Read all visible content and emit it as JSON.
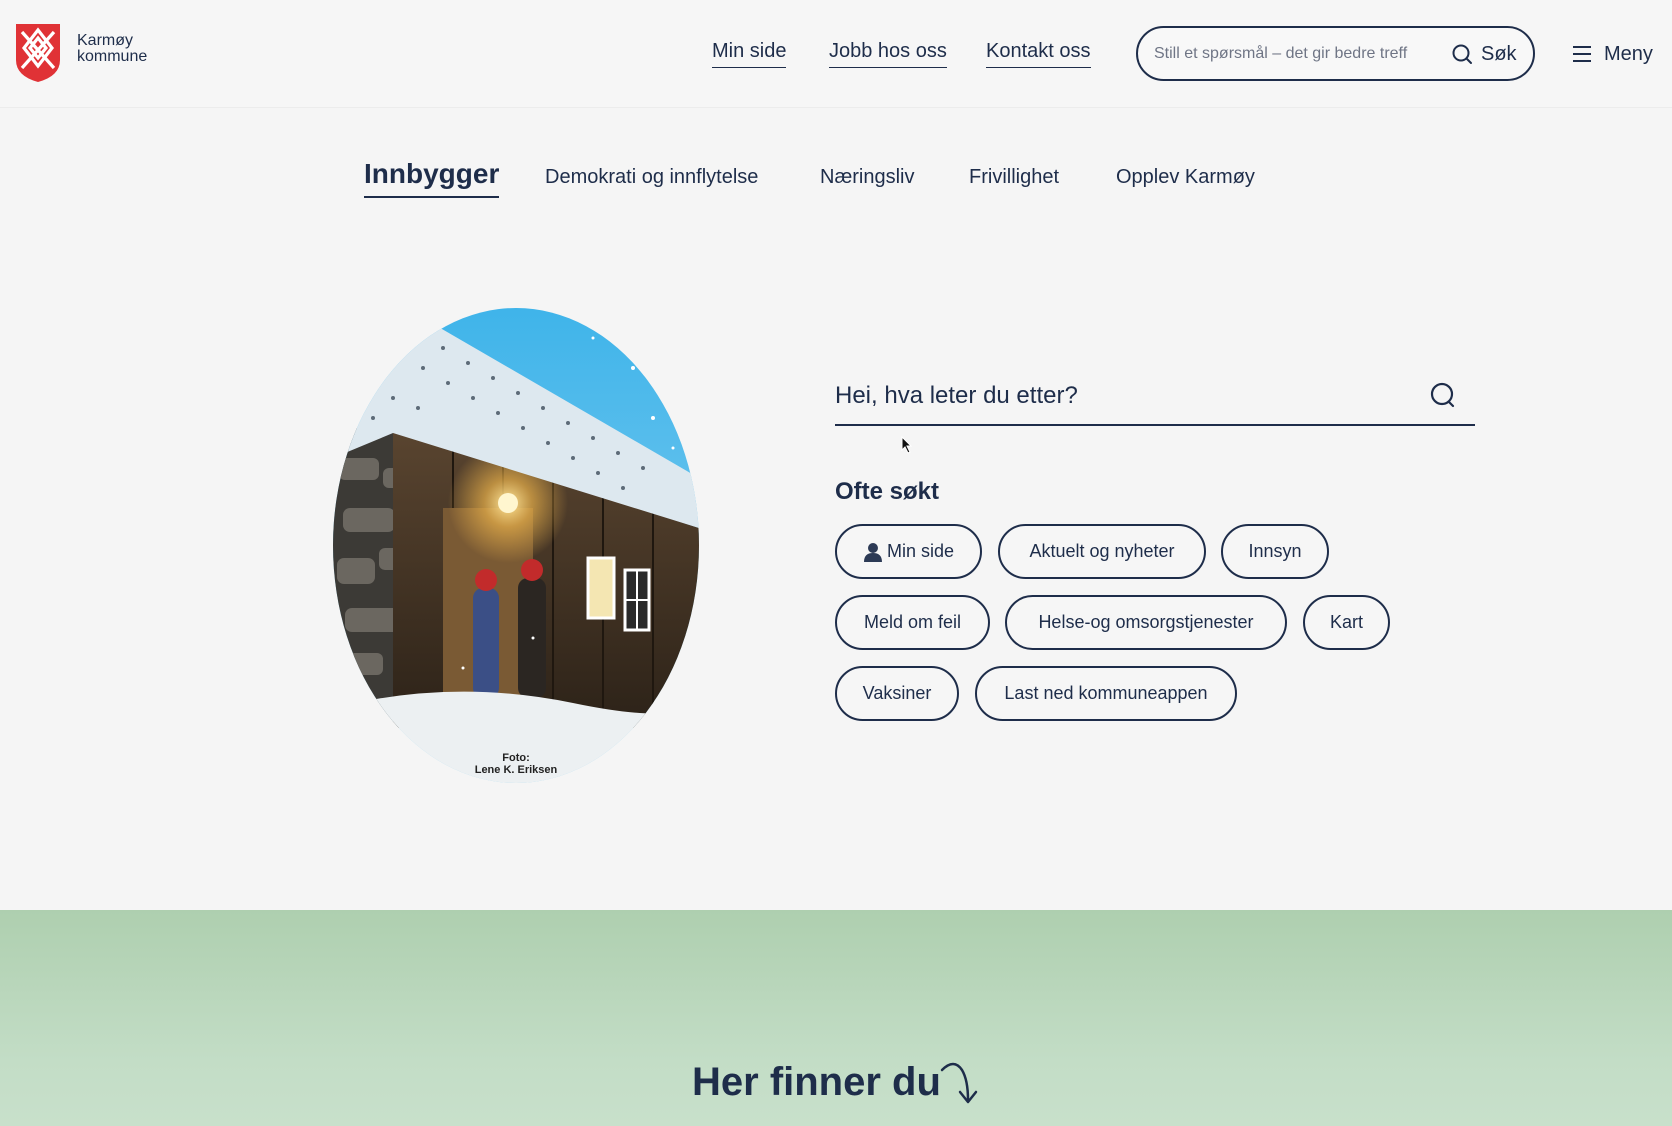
{
  "header": {
    "logo": {
      "name_line1": "Karmøy",
      "name_line2": "kommune",
      "shield_color": "#e03236"
    },
    "nav": [
      {
        "label": "Min side"
      },
      {
        "label": "Jobb hos oss"
      },
      {
        "label": "Kontakt oss"
      }
    ],
    "search": {
      "placeholder": "Still et spørsmål – det gir bedre treff",
      "button_label": "Søk"
    },
    "menu_label": "Meny"
  },
  "category_tabs": [
    {
      "label": "Innbygger",
      "active": true
    },
    {
      "label": "Demokrati og innflytelse"
    },
    {
      "label": "Næringsliv"
    },
    {
      "label": "Frivillighet"
    },
    {
      "label": "Opplev Karmøy"
    }
  ],
  "hero": {
    "photo_credit_line1": "Foto:",
    "photo_credit_line2": "Lene K. Eriksen",
    "search_placeholder": "Hei, hva leter du etter?",
    "often_searched_title": "Ofte søkt",
    "chips": [
      {
        "label": "Min side",
        "icon": "person-icon"
      },
      {
        "label": "Aktuelt og nyheter"
      },
      {
        "label": "Innsyn"
      },
      {
        "label": "Meld om feil"
      },
      {
        "label": "Helse-og omsorgstjenester"
      },
      {
        "label": "Kart"
      },
      {
        "label": "Vaksiner"
      },
      {
        "label": "Last ned kommuneappen"
      }
    ]
  },
  "bottom": {
    "title": "Her finner du"
  },
  "colors": {
    "text": "#1e2d4a",
    "background": "#f5f5f5",
    "green_band": "#b8d6bb"
  }
}
